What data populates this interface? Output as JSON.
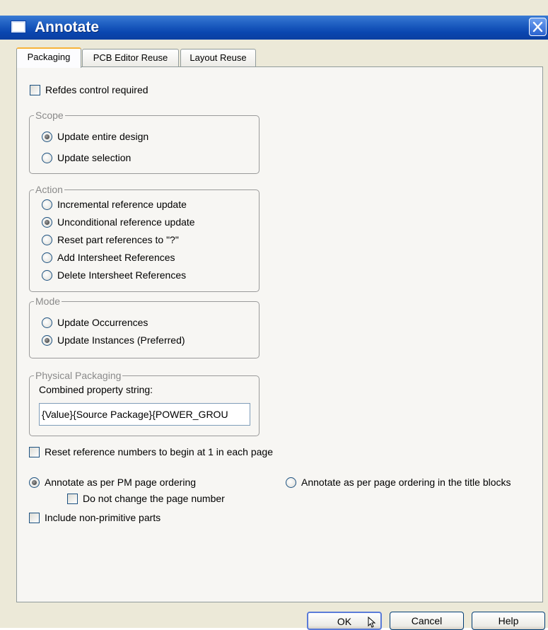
{
  "window": {
    "title": "Annotate"
  },
  "tabs": [
    {
      "label": "Packaging"
    },
    {
      "label": "PCB Editor Reuse"
    },
    {
      "label": "Layout Reuse"
    }
  ],
  "options": {
    "refdes_control": {
      "label": "Refdes control required",
      "checked": false
    }
  },
  "scope": {
    "legend": "Scope",
    "items": [
      {
        "label": "Update entire design",
        "selected": true
      },
      {
        "label": "Update selection",
        "selected": false
      }
    ]
  },
  "action": {
    "legend": "Action",
    "items": [
      {
        "label": "Incremental reference update",
        "selected": false
      },
      {
        "label": "Unconditional reference update",
        "selected": true
      },
      {
        "label": "Reset part references to \"?\"",
        "selected": false
      },
      {
        "label": "Add Intersheet References",
        "selected": false
      },
      {
        "label": "Delete Intersheet References",
        "selected": false
      }
    ]
  },
  "mode": {
    "legend": "Mode",
    "items": [
      {
        "label": "Update Occurrences",
        "selected": false
      },
      {
        "label": "Update Instances (Preferred)",
        "selected": true
      }
    ]
  },
  "physical": {
    "legend": "Physical Packaging",
    "field_label": "Combined property string:",
    "field_value": "{Value}{Source Package}{POWER_GROU"
  },
  "reset_numbers": {
    "label": "Reset reference numbers to begin at 1 in each page",
    "checked": false
  },
  "ordering": {
    "pm": {
      "label": "Annotate as per PM page ordering",
      "selected": true
    },
    "title_blocks": {
      "label": "Annotate as per page ordering in the title blocks",
      "selected": false
    },
    "no_change_page": {
      "label": "Do not change the page number",
      "checked": false
    }
  },
  "include_nonprimitive": {
    "label": "Include non-primitive parts",
    "checked": false
  },
  "buttons": {
    "ok": "OK",
    "cancel": "Cancel",
    "help": "Help"
  }
}
